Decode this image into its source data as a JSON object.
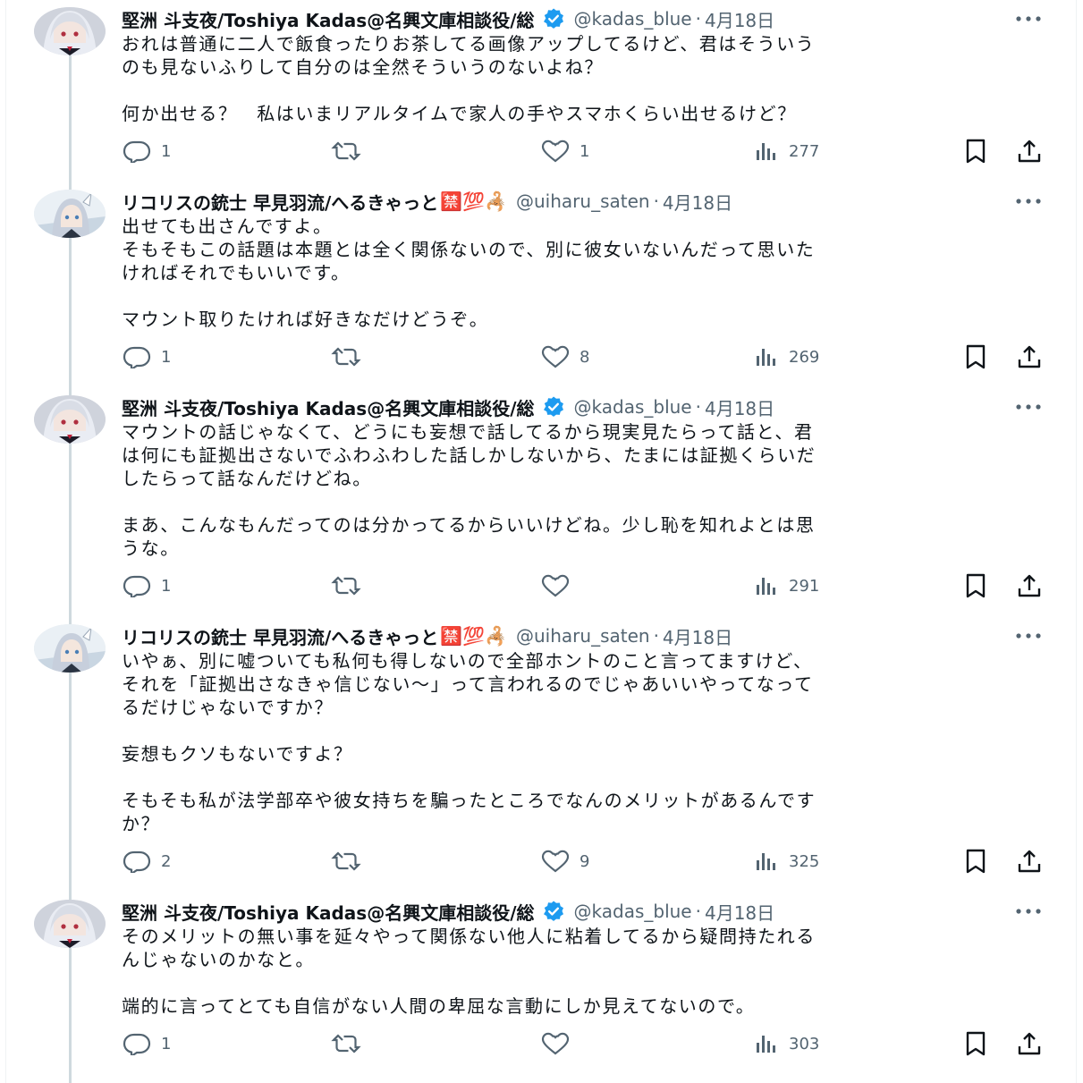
{
  "tweets": [
    {
      "name": "堅洲 斗支夜/Toshiya Kadas@名興文庫相談役/総",
      "verified": true,
      "handle": "@kadas_blue",
      "date": "4月18日",
      "lines": [
        "おれは普通に二人で飯食ったりお茶してる画像アップしてるけど、君はそういう",
        "のも見ないふりして自分のは全然そういうのないよね？",
        "",
        "何か出せる？　私はいまリアルタイムで家人の手やスマホくらい出せるけど？"
      ],
      "replies": "1",
      "retweets": "",
      "likes": "1",
      "views": "277"
    },
    {
      "name": "リコリスの銃士 早見羽流/へるきゃっと",
      "emoji": "🈲💯🦂",
      "verified": false,
      "handle": "@uiharu_saten",
      "date": "4月18日",
      "lines": [
        "出せても出さんですよ。",
        "そもそもこの話題は本題とは全く関係ないので、別に彼女いないんだって思いた",
        "ければそれでもいいです。",
        "",
        "マウント取りたければ好きなだけどうぞ。"
      ],
      "replies": "1",
      "retweets": "",
      "likes": "8",
      "views": "269"
    },
    {
      "name": "堅洲 斗支夜/Toshiya Kadas@名興文庫相談役/総",
      "verified": true,
      "handle": "@kadas_blue",
      "date": "4月18日",
      "lines": [
        "マウントの話じゃなくて、どうにも妄想で話してるから現実見たらって話と、君",
        "は何にも証拠出さないでふわふわした話しかしないから、たまには証拠くらいだ",
        "したらって話なんだけどね。",
        "",
        "まあ、こんなもんだってのは分かってるからいいけどね。少し恥を知れよとは思",
        "うな。"
      ],
      "replies": "1",
      "retweets": "",
      "likes": "",
      "views": "291"
    },
    {
      "name": "リコリスの銃士 早見羽流/へるきゃっと",
      "emoji": "🈲💯🦂",
      "verified": false,
      "handle": "@uiharu_saten",
      "date": "4月18日",
      "lines": [
        "いやぁ、別に嘘ついても私何も得しないので全部ホントのこと言ってますけど、",
        "それを「証拠出さなきゃ信じない〜」って言われるのでじゃあいいやってなって",
        "るだけじゃないですか？",
        "",
        "妄想もクソもないですよ？",
        "",
        "そもそも私が法学部卒や彼女持ちを騙ったところでなんのメリットがあるんです",
        "か？"
      ],
      "replies": "2",
      "retweets": "",
      "likes": "9",
      "views": "325"
    },
    {
      "name": "堅洲 斗支夜/Toshiya Kadas@名興文庫相談役/総",
      "verified": true,
      "handle": "@kadas_blue",
      "date": "4月18日",
      "lines": [
        "そのメリットの無い事を延々やって関係ない他人に粘着してるから疑問持たれる",
        "んじゃないのかなと。",
        "",
        "端的に言ってとても自信がない人間の卑屈な言動にしか見えてないので。"
      ],
      "replies": "1",
      "retweets": "",
      "likes": "",
      "views": "303"
    }
  ],
  "icons": {
    "reply": "reply-icon",
    "retweet": "retweet-icon",
    "like": "heart-icon",
    "views": "views-icon",
    "bookmark": "bookmark-icon",
    "share": "share-icon",
    "more": "more-icon",
    "verified": "verified-badge-icon"
  },
  "colors": {
    "text": "#0f1419",
    "secondary": "#536471",
    "verified": "#1d9bf0",
    "thread_line": "#cfd9de"
  }
}
